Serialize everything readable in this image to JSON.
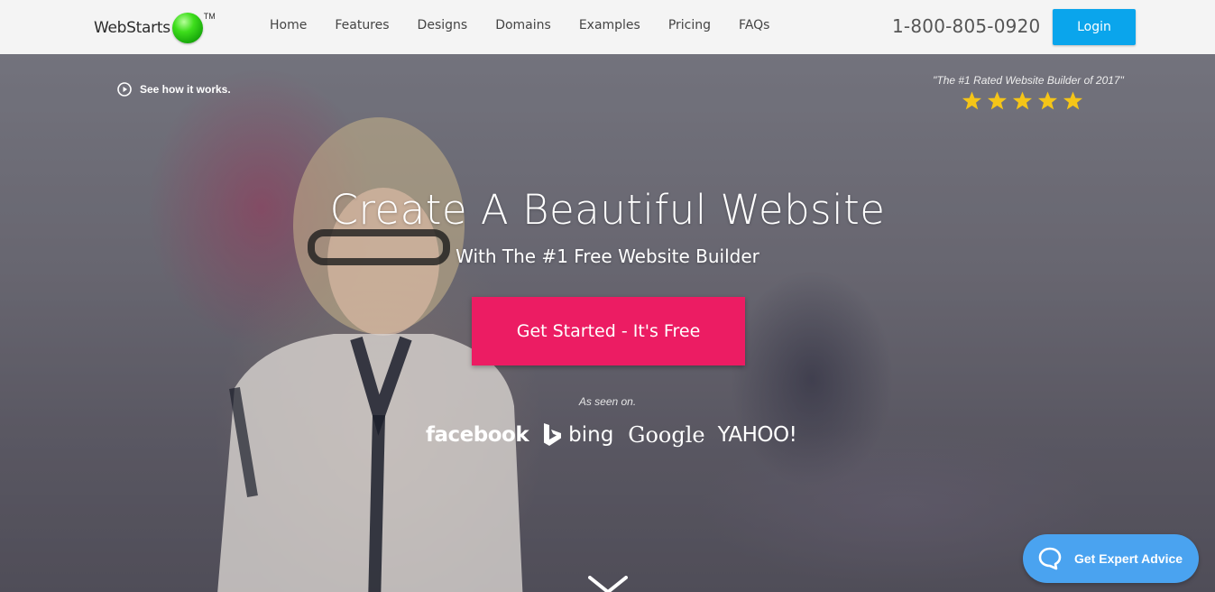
{
  "header": {
    "logo_text": "WebStarts",
    "logo_tm": "TM",
    "nav": [
      {
        "label": "Home"
      },
      {
        "label": "Features"
      },
      {
        "label": "Designs"
      },
      {
        "label": "Domains"
      },
      {
        "label": "Examples"
      },
      {
        "label": "Pricing"
      },
      {
        "label": "FAQs"
      }
    ],
    "phone": "1-800-805-0920",
    "login_label": "Login"
  },
  "hero": {
    "see_how_label": "See how it works.",
    "rating_text": "\"The #1 Rated Website Builder of 2017\"",
    "rating_stars": 5,
    "title": "Create A Beautiful Website",
    "subtitle": "With The #1 Free Website Builder",
    "cta_label": "Get Started - It's Free",
    "as_seen_on": "As seen on.",
    "press_logos": [
      "facebook",
      "bing",
      "Google",
      "YAHOO!"
    ]
  },
  "chat": {
    "label": "Get Expert Advice"
  },
  "colors": {
    "login": "#0aa5ec",
    "cta": "#ec1c63",
    "chat": "#4aa3f0",
    "star": "#f5c518",
    "logo_ball": "#3ede1c"
  }
}
